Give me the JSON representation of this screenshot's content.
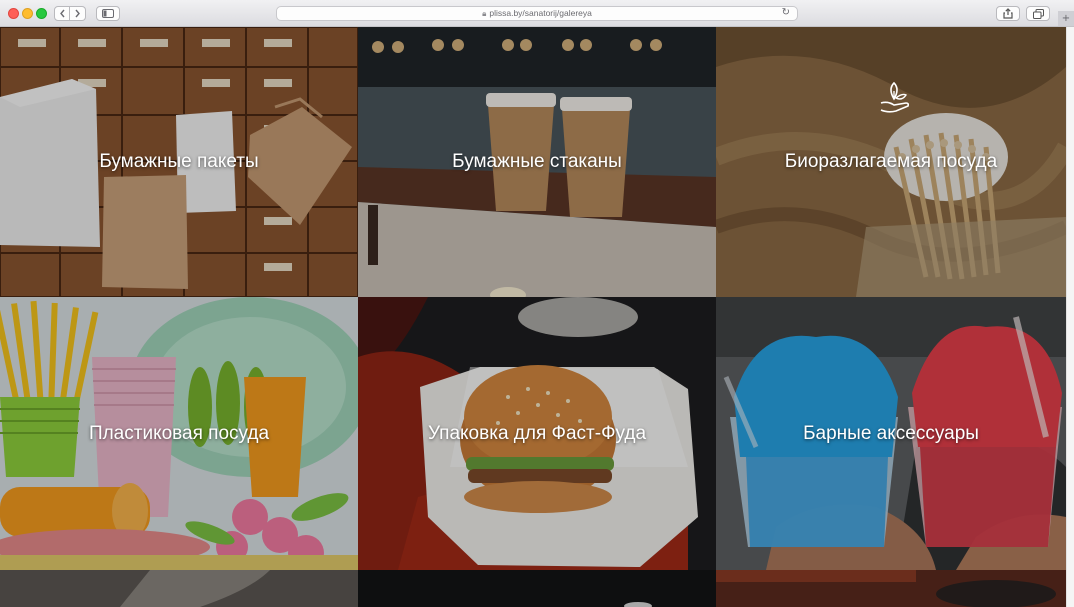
{
  "browser": {
    "url": "plissa.by/sanatorij/galereya",
    "back_icon": "chevron-left-icon",
    "forward_icon": "chevron-right-icon",
    "reload_icon": "reload-icon",
    "tab_add": "+"
  },
  "gallery": {
    "tiles": [
      {
        "label": "Бумажные пакеты"
      },
      {
        "label": "Бумажные стаканы"
      },
      {
        "label": "Биоразлагаемая посуда"
      },
      {
        "label": "Пластиковая посуда"
      },
      {
        "label": "Упаковка для Фаст-Фуда"
      },
      {
        "label": "Барные аксессуары"
      }
    ]
  }
}
